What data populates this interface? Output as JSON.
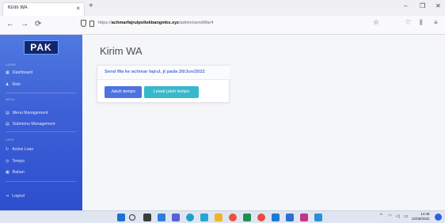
{
  "browser": {
    "tab_title": "Kirim WA",
    "tab_close": "×",
    "new_tab": "+",
    "window_controls": [
      "–",
      "❐",
      "✕"
    ],
    "nav": {
      "back": "←",
      "forward": "→",
      "reload": "⟳"
    },
    "url_prefix": "https://",
    "url_host": "achmarfajrulpoltekbangmks.xyz",
    "url_path": "/admin/sendWa/4"
  },
  "app": {
    "brand": "PAK",
    "sidebar": {
      "sections": [
        {
          "heading": "ADMIN",
          "items": [
            {
              "label": "Dashboard",
              "icon": "dashboard-icon"
            },
            {
              "label": "Role",
              "icon": "user-icon"
            }
          ]
        },
        {
          "heading": "MENU",
          "items": [
            {
              "label": "Menu Management",
              "icon": "folder-icon"
            },
            {
              "label": "Submenu Management",
              "icon": "folder-icon"
            }
          ]
        },
        {
          "heading": "USER",
          "items": [
            {
              "label": "Active Loan",
              "icon": "refresh-icon"
            },
            {
              "label": "Tempo",
              "icon": "clock-icon"
            },
            {
              "label": "Bahan",
              "icon": "box-icon"
            }
          ]
        }
      ],
      "logout": "Logout"
    },
    "page_title": "Kirim WA",
    "card": {
      "header": "Send Wa ke achmar fajrul, jt pada 20/Jun/2022",
      "buttons": {
        "primary": "Jatuh tempo",
        "secondary": "Lewat jatuh tempo"
      }
    },
    "colors": {
      "primary": "#4e73df",
      "info": "#36b9cc",
      "sidebar": "#3d5fd6"
    }
  },
  "taskbar": {
    "time": "14:45",
    "date": "22/06/2022"
  }
}
